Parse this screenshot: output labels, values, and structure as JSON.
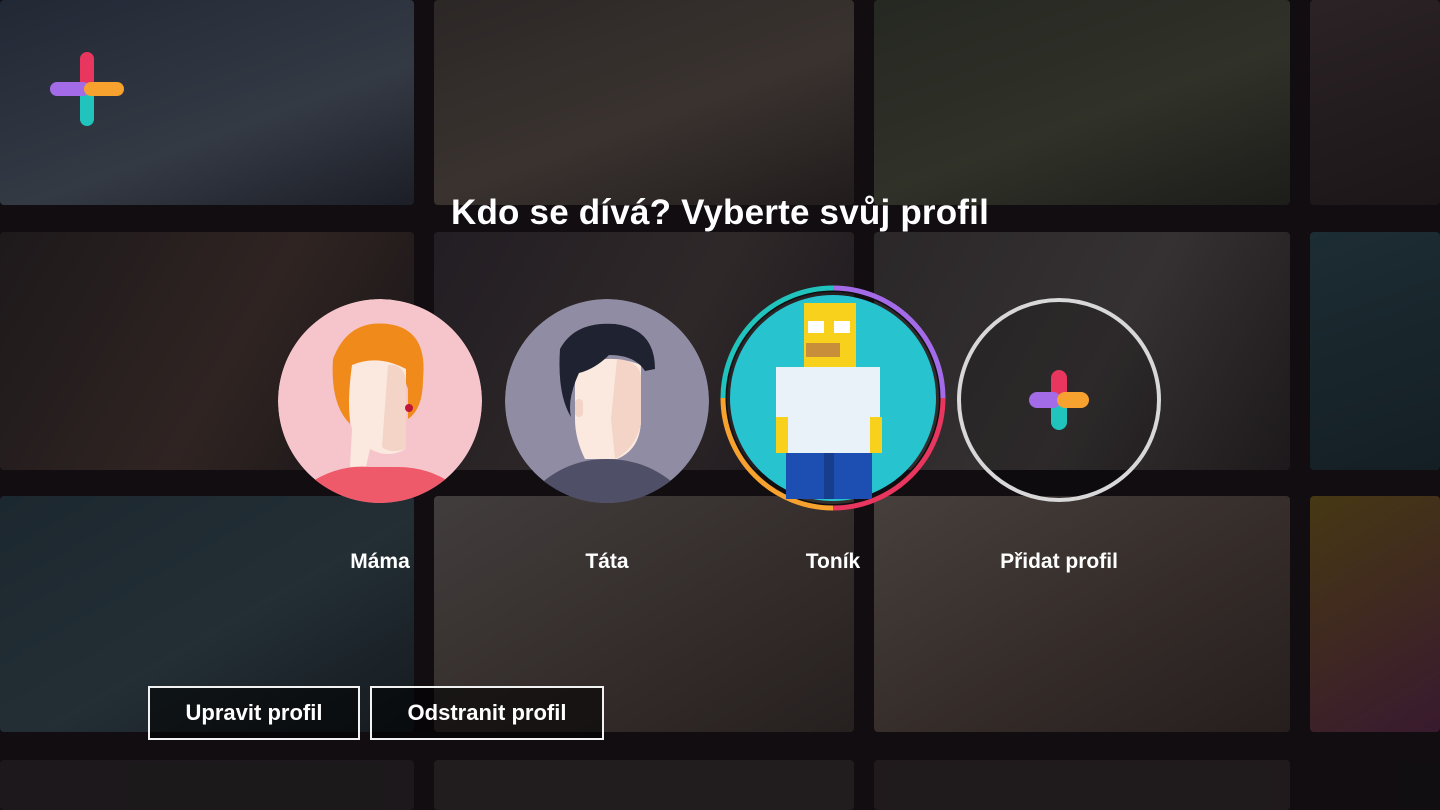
{
  "header": {
    "title": "Kdo se dívá? Vyberte svůj profil"
  },
  "profiles": [
    {
      "name": "Máma",
      "icon": "woman-avatar-icon",
      "color": "#f6c5cb"
    },
    {
      "name": "Táta",
      "icon": "man-avatar-icon",
      "color": "#8f8ca3"
    },
    {
      "name": "Toník",
      "icon": "pixel-character-avatar-icon",
      "color": "#27c3cf",
      "selected": true
    },
    {
      "name": "Přidat profil",
      "icon": "add-plus-icon"
    }
  ],
  "actions": {
    "edit_label": "Upravit profil",
    "delete_label": "Odstranit profil"
  },
  "brand_colors": {
    "purple": "#a46be8",
    "orange": "#f7a12f",
    "teal": "#20c4bd",
    "red": "#e9365f"
  }
}
